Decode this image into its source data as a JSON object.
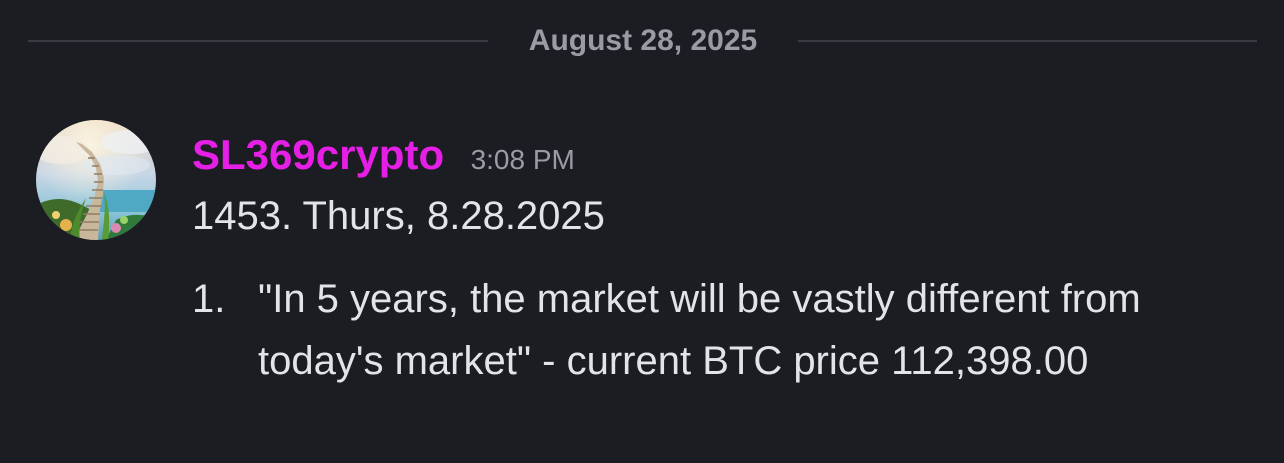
{
  "divider": {
    "date": "August 28, 2025"
  },
  "message": {
    "author": "SL369crypto",
    "author_color": "#e61fe6",
    "time": "3:08 PM",
    "avatar_icon": "stairway-to-heaven-avatar",
    "body_line": "1453.  Thurs, 8.28.2025",
    "list": [
      {
        "number": "1.",
        "text": "\"In 5 years, the market will be vastly different from today's market\" - current BTC price 112,398.00"
      }
    ]
  }
}
